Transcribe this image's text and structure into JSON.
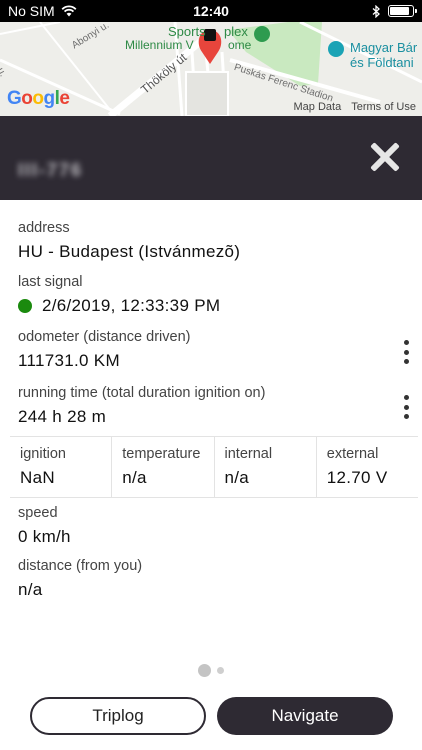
{
  "status_bar": {
    "carrier": "No SIM",
    "time": "12:40"
  },
  "map": {
    "labels": {
      "sports": "Sports",
      "complex": "plex",
      "millennium": "Millennium V",
      "millennium_end": "ome",
      "magyar": "Magyar Bár",
      "foldtani": "és Földtani",
      "thokoly": "Thököly út",
      "abonyi": "Abonyi u.",
      "puskas": "Puskás Ferenc Stadion",
      "left_street": "u."
    },
    "google": [
      "G",
      "o",
      "o",
      "g",
      "l",
      "e"
    ],
    "footer": {
      "map_data": "Map Data",
      "terms": "Terms of Use"
    }
  },
  "header": {
    "plate": "III-776"
  },
  "fields": {
    "address": {
      "label": "address",
      "value": "HU - Budapest (Istvánmezõ)"
    },
    "last_signal": {
      "label": "last signal",
      "value": "2/6/2019, 12:33:39 PM"
    },
    "odometer": {
      "label": "odometer (distance driven)",
      "value": "111731.0 KM"
    },
    "running_time": {
      "label": "running time (total duration ignition on)",
      "value": "244 h 28 m"
    },
    "speed": {
      "label": "speed",
      "value": "0 km/h"
    },
    "distance": {
      "label": "distance (from you)",
      "value": "n/a"
    }
  },
  "grid": [
    {
      "label": "ignition",
      "value": "NaN"
    },
    {
      "label": "temperature",
      "value": "n/a"
    },
    {
      "label": "internal",
      "value": "n/a"
    },
    {
      "label": "external",
      "value": "12.70 V"
    }
  ],
  "colors": {
    "header_bg": "#2e2a33",
    "signal_ok": "#1b8a0e",
    "pin": "#e8453c"
  },
  "buttons": {
    "triplog": "Triplog",
    "navigate": "Navigate"
  }
}
